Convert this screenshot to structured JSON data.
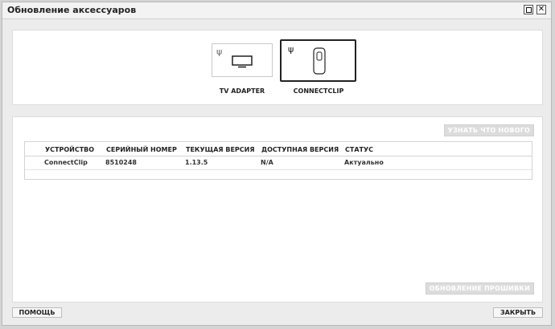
{
  "window": {
    "title": "Обновление аксессуаров"
  },
  "accessories": [
    {
      "label": "TV ADAPTER",
      "icon": "usb-icon",
      "device_icon": "tv-monitor-icon",
      "selected": false
    },
    {
      "label": "CONNECTCLIP",
      "icon": "usb-icon",
      "device_icon": "connectclip-device-icon",
      "selected": true
    }
  ],
  "actions": {
    "whats_new": "УЗНАТЬ ЧТО НОВОГО",
    "firmware_update": "ОБНОВЛЕНИЕ ПРОШИВКИ"
  },
  "table": {
    "headers": [
      "УСТРОЙСТВО",
      "СЕРИЙНЫЙ НОМЕР",
      "ТЕКУЩАЯ ВЕРСИЯ",
      "ДОСТУПНАЯ ВЕРСИЯ",
      "СТАТУС"
    ],
    "rows": [
      {
        "device": "ConnectClip",
        "serial": "8510248",
        "current": "1.13.5",
        "available": "N/A",
        "status": "Актуально"
      }
    ]
  },
  "footer": {
    "help": "ПОМОЩЬ",
    "close": "ЗАКРЫТЬ"
  }
}
